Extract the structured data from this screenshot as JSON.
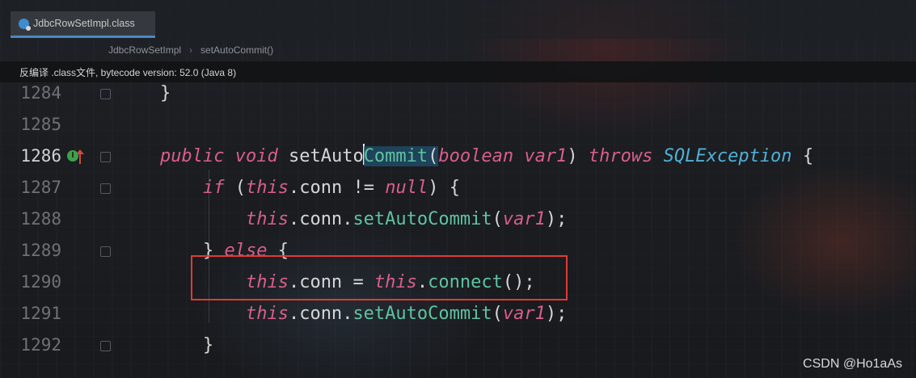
{
  "tab": {
    "label": "JdbcRowSetImpl.class",
    "icon": "class-file-icon"
  },
  "breadcrumb": {
    "items": [
      "JdbcRowSetImpl",
      "setAutoCommit()"
    ],
    "separator": "›"
  },
  "info_bar": {
    "text": "反编译 .class文件, bytecode version: 52.0 (Java 8)"
  },
  "editor": {
    "current_line": "1286",
    "lines": [
      {
        "number": "1284"
      },
      {
        "number": "1285"
      },
      {
        "number": "1286"
      },
      {
        "number": "1287"
      },
      {
        "number": "1288"
      },
      {
        "number": "1289"
      },
      {
        "number": "1290"
      },
      {
        "number": "1291"
      },
      {
        "number": "1292"
      }
    ],
    "tokens": {
      "brace_close": "}",
      "kw_public": "public",
      "kw_void": "void",
      "m_setAuto": "setAuto",
      "m_Commit": "Commit",
      "paren_open": "(",
      "kw_boolean": "boolean",
      "var1": "var1",
      "paren_close": ")",
      "kw_throws": "throws",
      "t_SQLException": "SQLException",
      "brace_open": "{",
      "kw_if": "if",
      "kw_this": "this",
      "dot_conn": ".conn",
      "op_neq": "!=",
      "kw_null": "null",
      "dot": ".",
      "m_setAutoCommit": "setAutoCommit",
      "semi": ");",
      "kw_else": "else",
      "op_eq": "=",
      "m_connect": "connect",
      "empty_call": "();"
    }
  },
  "gutter": {
    "override_icon": "implements-method-icon",
    "override_glyph": "I",
    "arrow_icon": "go-to-super-arrow-icon"
  },
  "annotation": {
    "box_color": "#e03a36"
  },
  "watermark": "CSDN @Ho1aAs"
}
